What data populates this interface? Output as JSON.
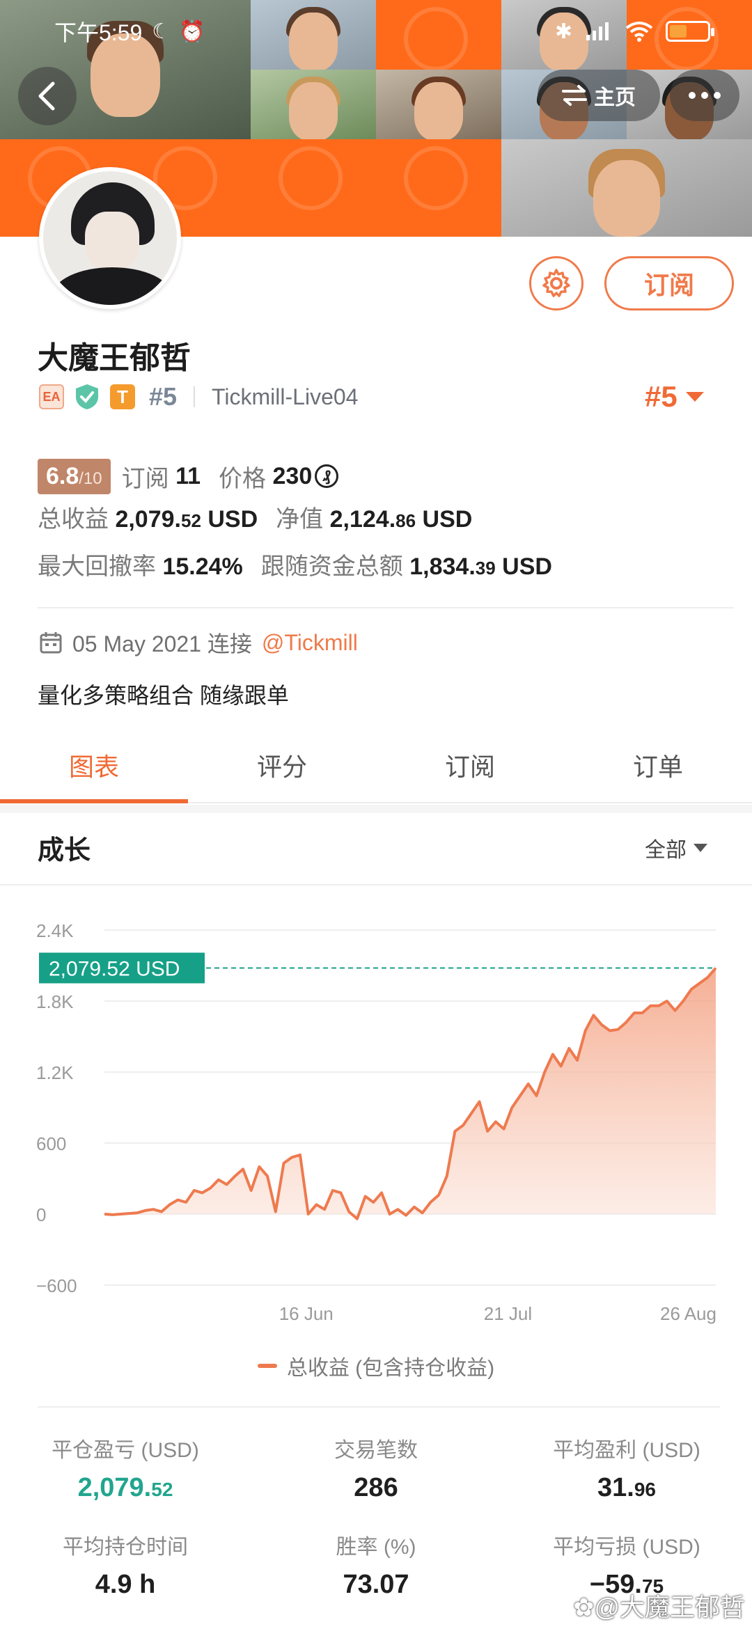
{
  "status_bar": {
    "time": "下午5:59"
  },
  "header": {
    "home_label": "主页"
  },
  "profile": {
    "name": "大魔王郁哲",
    "badge_ea": "EA",
    "badge_t": "T",
    "rank": "#5",
    "server": "Tickmill-Live04",
    "rank_right": "#5",
    "subscribe_label": "订阅"
  },
  "stats": {
    "score": "6.8",
    "score_max": "/10",
    "subscribers_label": "订阅",
    "subscribers": "11",
    "price_label": "价格",
    "price": "230",
    "total_profit_label": "总收益",
    "total_profit_main": "2,079.",
    "total_profit_dec": "52",
    "total_profit_unit": "USD",
    "equity_label": "净值",
    "equity_main": "2,124.",
    "equity_dec": "86",
    "equity_unit": "USD",
    "drawdown_label": "最大回撤率",
    "drawdown": "15.24%",
    "follow_label": "跟随资金总额",
    "follow_main": "1,834.",
    "follow_dec": "39",
    "follow_unit": "USD"
  },
  "joined": {
    "date": "05 May 2021 连接",
    "broker": "@Tickmill"
  },
  "bio": "量化多策略组合 随缘跟单",
  "tabs": [
    {
      "label": "图表",
      "active": true
    },
    {
      "label": "评分",
      "active": false
    },
    {
      "label": "订阅",
      "active": false
    },
    {
      "label": "订单",
      "active": false
    }
  ],
  "growth": {
    "title": "成长",
    "filter": "全部"
  },
  "chart_data": {
    "type": "area",
    "ylim": [
      -600,
      2400
    ],
    "yticks": [
      2400,
      1800,
      1200,
      600,
      0,
      -600
    ],
    "ytick_labels": [
      "2.4K",
      "1.8K",
      "1.2K",
      "600",
      "0",
      "−600"
    ],
    "xtick_labels": [
      "16 Jun",
      "21 Jul",
      "26 Aug"
    ],
    "current_value_label": "2,079.52 USD",
    "current_value": 2079.52,
    "series": [
      {
        "name": "总收益 (包含持仓收益)",
        "color": "#ee7a4f",
        "values": [
          0,
          -5,
          0,
          5,
          10,
          30,
          40,
          20,
          80,
          120,
          100,
          200,
          180,
          220,
          290,
          250,
          320,
          380,
          200,
          400,
          320,
          20,
          430,
          480,
          500,
          0,
          80,
          40,
          200,
          180,
          20,
          -40,
          150,
          100,
          180,
          0,
          40,
          -10,
          60,
          10,
          100,
          160,
          320,
          700,
          750,
          850,
          950,
          700,
          780,
          720,
          900,
          1000,
          1100,
          1000,
          1200,
          1350,
          1250,
          1400,
          1300,
          1550,
          1680,
          1600,
          1550,
          1560,
          1620,
          1700,
          1700,
          1760,
          1760,
          1800,
          1720,
          1800,
          1900,
          1950,
          2000,
          2079.52
        ]
      }
    ]
  },
  "legend": {
    "label": "总收益 (包含持仓收益)"
  },
  "summary": [
    {
      "label": "平仓盈亏 (USD)",
      "main": "2,079.",
      "dec": "52",
      "green": true
    },
    {
      "label": "交易笔数",
      "main": "286",
      "dec": "",
      "green": false
    },
    {
      "label": "平均盈利 (USD)",
      "main": "31.",
      "dec": "96",
      "green": false
    },
    {
      "label": "平均持仓时间",
      "main": "4.9 h",
      "dec": "",
      "green": false
    },
    {
      "label": "胜率 (%)",
      "main": "73.07",
      "dec": "",
      "green": false
    },
    {
      "label": "平均亏损 (USD)",
      "main": "−59.",
      "dec": "75",
      "green": false
    }
  ],
  "watermark": "大魔王郁哲",
  "colors": {
    "accent": "#f06a35",
    "header_orange": "#ff6a1a",
    "green_value": "#21a58e",
    "teal_label": "#16a087"
  }
}
